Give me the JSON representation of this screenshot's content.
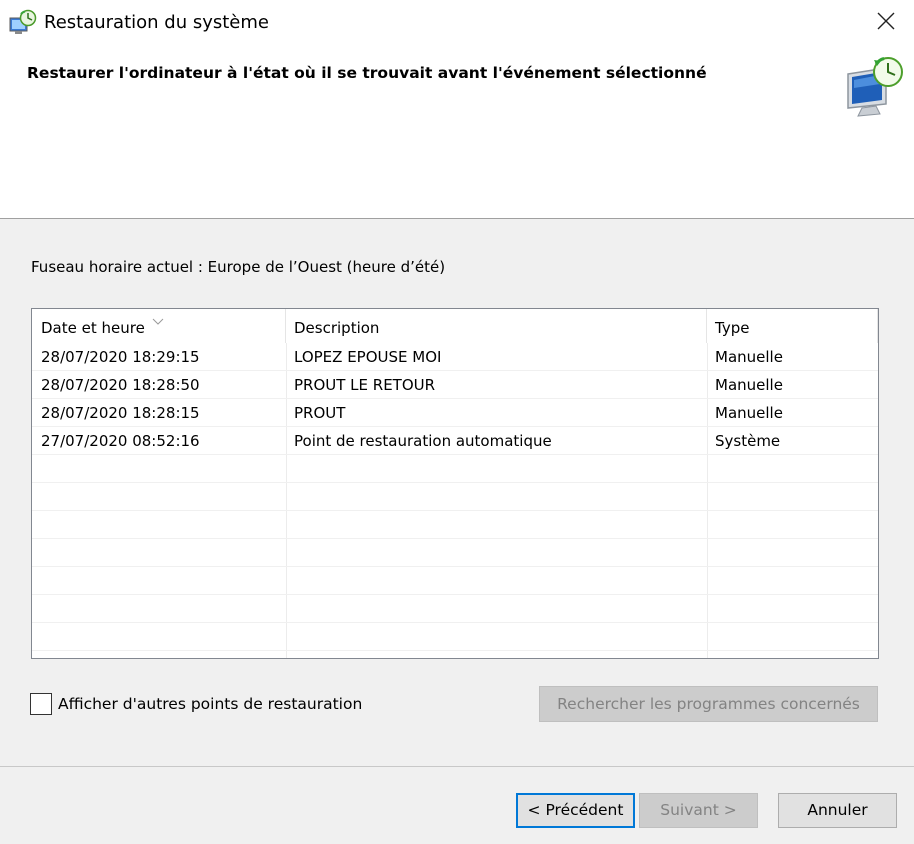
{
  "window": {
    "title": "Restauration du système",
    "app_icon": "system-restore-icon",
    "close_icon": "close-icon"
  },
  "header": {
    "instruction": "Restaurer l'ordinateur à l'état où il se trouvait avant l'événement sélectionné",
    "icon": "system-restore-monitor-icon"
  },
  "timezone": {
    "label": "Fuseau horaire actuel : Europe de l’Ouest (heure d’été)"
  },
  "table": {
    "columns": [
      "Date et heure",
      "Description",
      "Type"
    ],
    "sorted_by": "Date et heure",
    "rows": [
      {
        "date": "28/07/2020 18:29:15",
        "description": "LOPEZ EPOUSE MOI",
        "type": "Manuelle"
      },
      {
        "date": "28/07/2020 18:28:50",
        "description": "PROUT LE RETOUR",
        "type": "Manuelle"
      },
      {
        "date": "28/07/2020 18:28:15",
        "description": "PROUT",
        "type": "Manuelle"
      },
      {
        "date": "27/07/2020 08:52:16",
        "description": "Point de restauration automatique",
        "type": "Système"
      }
    ]
  },
  "options": {
    "show_more_label": "Afficher d'autres points de restauration",
    "show_more_checked": false,
    "scan_button_label": "Rechercher les programmes concernés",
    "scan_button_enabled": false
  },
  "buttons": {
    "previous": "< Précédent",
    "next": "Suivant >",
    "next_enabled": false,
    "cancel": "Annuler"
  },
  "colors": {
    "focus_border": "#0078d7",
    "disabled_text": "#838383"
  }
}
